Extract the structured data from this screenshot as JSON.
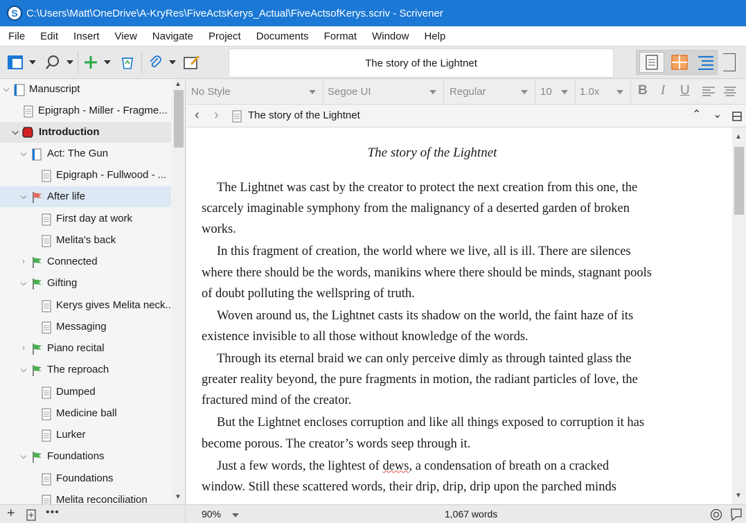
{
  "window": {
    "title": "C:\\Users\\Matt\\OneDrive\\A-KryRes\\FiveActsKerys_Actual\\FiveActsofKerys.scriv - Scrivener",
    "app_icon": "S"
  },
  "menu": [
    "File",
    "Edit",
    "Insert",
    "View",
    "Navigate",
    "Project",
    "Documents",
    "Format",
    "Window",
    "Help"
  ],
  "toolbar": {
    "document_title": "The story of the Lightnet"
  },
  "binder": {
    "items": [
      {
        "label": "Manuscript"
      },
      {
        "label": "Epigraph - Miller - Fragme..."
      },
      {
        "label": "Introduction"
      },
      {
        "label": "Act: The Gun"
      },
      {
        "label": "Epigraph - Fullwood - ..."
      },
      {
        "label": "After life"
      },
      {
        "label": "First day at work"
      },
      {
        "label": "Melita's back"
      },
      {
        "label": "Connected"
      },
      {
        "label": "Gifting"
      },
      {
        "label": "Kerys gives Melita neck..."
      },
      {
        "label": "Messaging"
      },
      {
        "label": "Piano recital"
      },
      {
        "label": "The reproach"
      },
      {
        "label": "Dumped"
      },
      {
        "label": "Medicine ball"
      },
      {
        "label": "Lurker"
      },
      {
        "label": "Foundations"
      },
      {
        "label": "Foundations"
      },
      {
        "label": "Melita reconciliation"
      }
    ]
  },
  "format_bar": {
    "style": "No Style",
    "font": "Segoe UI",
    "weight": "Regular",
    "size": "10",
    "spacing": "1.0x",
    "bold": "B",
    "italic": "I",
    "underline": "U"
  },
  "nav": {
    "doc_name": "The story of the Lightnet"
  },
  "editor": {
    "title": "The story of the Lightnet",
    "paragraphs": [
      "The Lightnet was cast by the creator to protect the next creation from this one, the scarcely imaginable symphony from the malignancy of a deserted garden of broken works.",
      "In this fragment of creation, the world where we live, all is ill. There are silences where there should be the words, manikins where there should be minds, stagnant pools of doubt polluting the wellspring of truth.",
      "Woven around us, the Lightnet casts its shadow on the world, the faint haze of its existence invisible to all those without knowledge of the words.",
      "Through its eternal braid we can only perceive dimly as through tainted glass the greater reality beyond, the pure fragments in motion, the radiant particles of love, the fractured mind of the creator.",
      "But the Lightnet encloses corruption and like all things exposed to corruption it has become porous. The creator’s words seep through it."
    ],
    "last_para_start": "Just a few words, the lightest of ",
    "last_para_word": "dews",
    "last_para_rest": ", a condensation of breath on a cracked window. Still these scattered words, their drip, drip, drip upon the parched minds"
  },
  "status": {
    "zoom": "90%",
    "word_count": "1,067 words"
  }
}
